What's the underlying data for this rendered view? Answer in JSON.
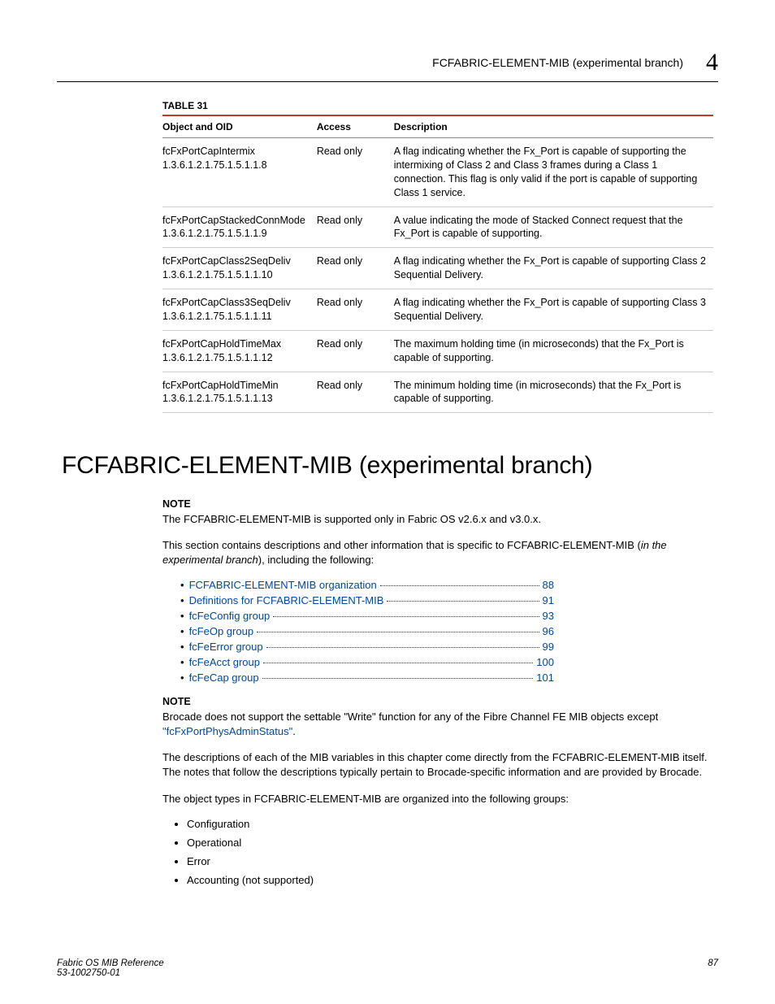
{
  "header": {
    "title": "FCFABRIC-ELEMENT-MIB (experimental branch)",
    "chapter": "4"
  },
  "table": {
    "label": "TABLE 31",
    "columns": [
      "Object and OID",
      "Access",
      "Description"
    ],
    "rows": [
      {
        "name": "fcFxPortCapIntermix",
        "oid": "1.3.6.1.2.1.75.1.5.1.1.8",
        "access": "Read only",
        "desc": "A flag indicating whether the Fx_Port is capable of supporting the intermixing of Class 2 and Class 3 frames during a Class 1 connection. This flag is only valid if the port is capable of supporting Class 1 service."
      },
      {
        "name": "fcFxPortCapStackedConnMode",
        "oid": "1.3.6.1.2.1.75.1.5.1.1.9",
        "access": "Read only",
        "desc": "A value indicating the mode of Stacked Connect request that the Fx_Port is capable of supporting."
      },
      {
        "name": "fcFxPortCapClass2SeqDeliv",
        "oid": "1.3.6.1.2.1.75.1.5.1.1.10",
        "access": "Read only",
        "desc": "A flag indicating whether the Fx_Port is capable of supporting Class 2 Sequential Delivery."
      },
      {
        "name": "fcFxPortCapClass3SeqDeliv",
        "oid": "1.3.6.1.2.1.75.1.5.1.1.11",
        "access": "Read only",
        "desc": "A flag indicating whether the Fx_Port is capable of supporting Class 3 Sequential Delivery."
      },
      {
        "name": "fcFxPortCapHoldTimeMax",
        "oid": "1.3.6.1.2.1.75.1.5.1.1.12",
        "access": "Read only",
        "desc": "The maximum holding time (in microseconds) that the Fx_Port is capable of supporting."
      },
      {
        "name": "fcFxPortCapHoldTimeMin",
        "oid": "1.3.6.1.2.1.75.1.5.1.1.13",
        "access": "Read only",
        "desc": "The minimum holding time (in microseconds) that the Fx_Port is capable of supporting."
      }
    ]
  },
  "section": {
    "heading": "FCFABRIC-ELEMENT-MIB (experimental branch)",
    "note1_label": "NOTE",
    "note1_text": "The FCFABRIC-ELEMENT-MIB is supported only in Fabric OS v2.6.x and v3.0.x.",
    "intro_pre": "This section contains descriptions and other information that is specific to FCFABRIC-ELEMENT-MIB (",
    "intro_em": "in the experimental branch",
    "intro_post": "), including the following:",
    "toc": [
      {
        "label": "FCFABRIC-ELEMENT-MIB organization",
        "page": "88"
      },
      {
        "label": "Definitions for FCFABRIC-ELEMENT-MIB",
        "page": "91"
      },
      {
        "label": "fcFeConfig group",
        "page": "93"
      },
      {
        "label": "fcFeOp group",
        "page": "96"
      },
      {
        "label": "fcFeError group",
        "page": "99"
      },
      {
        "label": "fcFeAcct group",
        "page": "100"
      },
      {
        "label": "fcFeCap group",
        "page": "101"
      }
    ],
    "note2_label": "NOTE",
    "note2_pre": "Brocade does not support the settable \"Write\" function for any of the Fibre Channel FE MIB objects except ",
    "note2_link": "\"fcFxPortPhysAdminStatus\"",
    "note2_post": ".",
    "para1": "The descriptions of each of the MIB variables in this chapter come directly from the FCFABRIC-ELEMENT-MIB itself. The notes that follow the descriptions typically pertain to Brocade-specific information and are provided by Brocade.",
    "para2": "The object types in FCFABRIC-ELEMENT-MIB are organized into the following groups:",
    "groups": [
      "Configuration",
      "Operational",
      "Error",
      "Accounting (not supported)"
    ]
  },
  "footer": {
    "left1": "Fabric OS MIB Reference",
    "left2": "53-1002750-01",
    "page": "87"
  }
}
